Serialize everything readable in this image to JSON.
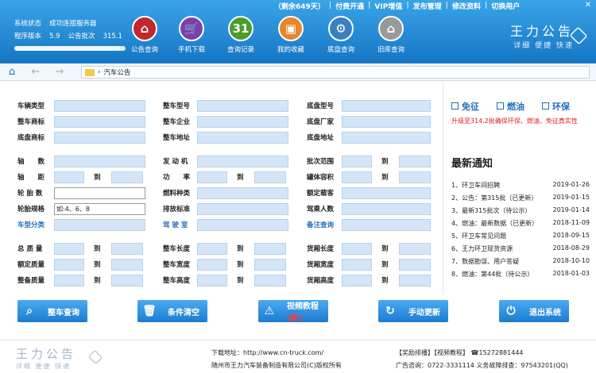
{
  "top": {
    "links": [
      "（剩余649天）",
      "付费开通",
      "VIP增值",
      "发布管理",
      "修改资料",
      "切换用户"
    ],
    "close": "✕"
  },
  "status": {
    "label1": "系统状态",
    "value1": "成功连接服务器",
    "label2": "程序版本",
    "value2": "5.9",
    "label3": "公告批次",
    "value3": "315.1",
    "progress": 0.95
  },
  "toolbar": [
    {
      "label": "公告查询",
      "icon": "document-icon",
      "glyph": "⌂",
      "color": "#c0282d"
    },
    {
      "label": "手机下载",
      "icon": "cart-icon",
      "glyph": "🛒",
      "color": "#7a3fb0"
    },
    {
      "label": "查询记录",
      "icon": "calendar-icon",
      "glyph": "31",
      "color": "#4a9d2a"
    },
    {
      "label": "我的收藏",
      "icon": "box-icon",
      "glyph": "▣",
      "color": "#e8862a"
    },
    {
      "label": "底盘查询",
      "icon": "gear-icon",
      "glyph": "⚙",
      "color": "#3a7fc0"
    },
    {
      "label": "旧库查询",
      "icon": "history-icon",
      "glyph": "⌂",
      "color": "#999999"
    }
  ],
  "brand": {
    "title": "王力公告",
    "subtitle": "详细 便捷 快速"
  },
  "nav": {
    "home": "⌂",
    "back": "←",
    "forward": "→",
    "address": "汽车公告"
  },
  "form": {
    "c1": [
      "车辆类型",
      "整车商标",
      "底盘商标",
      "轴　　数",
      "轴　　距",
      "轮 胎 数",
      "轮胎规格",
      "车型分类",
      "总 质 量",
      "额定质量",
      "整备质量"
    ],
    "c2": [
      "整车型号",
      "整车企业",
      "整车地址",
      "发 动 机",
      "功　　率",
      "燃料种类",
      "排放标准",
      "驾 驶 室",
      "整车长度",
      "整车宽度",
      "整车高度"
    ],
    "c3": [
      "底盘型号",
      "底盘厂家",
      "底盘地址",
      "批次范围",
      "罐体容积",
      "额定载客",
      "驾乘人数",
      "备注查询",
      "货厢长度",
      "货厢宽度",
      "货厢高度"
    ],
    "to": "到",
    "tire_spec_value": "如:4、6、8"
  },
  "side": {
    "env": [
      "免征",
      "燃油",
      "环保"
    ],
    "upgrade": "升级至314.2批确保环保、燃油、免征真实性",
    "notice_title": "最新通知",
    "notices": [
      {
        "text": "1、环卫车间招聘",
        "date": "2019-01-26"
      },
      {
        "text": "2、公告：第315批（已更新）",
        "date": "2019-01-15"
      },
      {
        "text": "3、最新315批次（待公示）",
        "date": "2019-01-14"
      },
      {
        "text": "4、燃油：最新数据（已更新）",
        "date": "2018-11-09"
      },
      {
        "text": "5、环卫车常见问题",
        "date": "2018-09-15"
      },
      {
        "text": "6、王力环卫现货资源",
        "date": "2018-08-29"
      },
      {
        "text": "7、数据勘误、用户答疑",
        "date": "2018-10-10"
      },
      {
        "text": "8、燃油：第44批（待公示）",
        "date": "2018-01-03"
      }
    ]
  },
  "buttons": [
    {
      "label": "整车查询",
      "icon": "search-icon",
      "glyph": "⌕"
    },
    {
      "label": "条件清空",
      "icon": "trash-icon",
      "glyph": "🗑"
    },
    {
      "label": "视频教程",
      "extra": "(新)",
      "icon": "warning-icon",
      "glyph": "⚠"
    },
    {
      "label": "手动更新",
      "icon": "refresh-icon",
      "glyph": "↻"
    },
    {
      "label": "退出系统",
      "icon": "power-icon",
      "glyph": "⏻"
    }
  ],
  "footer": {
    "brand": "王力公告",
    "brand_sub": "详细 便捷 快速",
    "download": "下载地址：http://www.cn-truck.com/",
    "copyright": "随州市王力汽车装备制造有限公司(C)版权所有",
    "links": "【奖励排播】【视频教程】 ☎15272881444",
    "phone": "广告咨询：0722-3331114  义务故障排查：97543201(QQ)"
  }
}
